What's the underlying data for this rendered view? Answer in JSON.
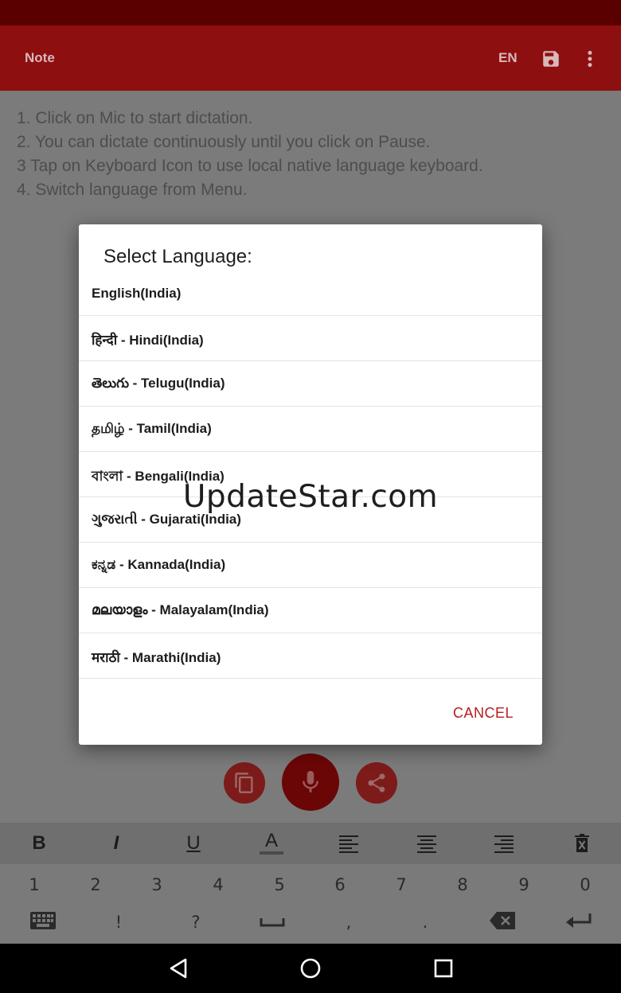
{
  "app": {
    "title": "Note",
    "language_code": "EN"
  },
  "instructions": [
    "1. Click on Mic to start dictation.",
    "2. You can dictate continuously until you click on Pause.",
    "3 Tap on Keyboard Icon to use local native language keyboard.",
    "4. Switch language from Menu."
  ],
  "dialog": {
    "title": "Select Language:",
    "items": [
      "English(India)",
      "हिन्दी - Hindi(India)",
      "తెలుగు - Telugu(India)",
      "தமிழ் - Tamil(India)",
      "বাংলা - Bengali(India)",
      "ગુજરાતી - Gujarati(India)",
      "ಕನ್ನಡ - Kannada(India)",
      "മലയാളം - Malayalam(India)",
      "मराठी - Marathi(India)"
    ],
    "cancel_label": "CANCEL"
  },
  "format_toolbar": {
    "bold": "B",
    "italic": "I",
    "underline": "U",
    "text_color": "A"
  },
  "keyboard": {
    "row1": [
      "1",
      "2",
      "3",
      "4",
      "5",
      "6",
      "7",
      "8",
      "9",
      "0"
    ],
    "row2": [
      "!",
      "?",
      ",",
      "."
    ]
  },
  "watermark": "UpdateStar.com",
  "colors": {
    "accent": "#b71c1c",
    "appbar": "#8e0f0f",
    "statusbar": "#5a0000"
  }
}
